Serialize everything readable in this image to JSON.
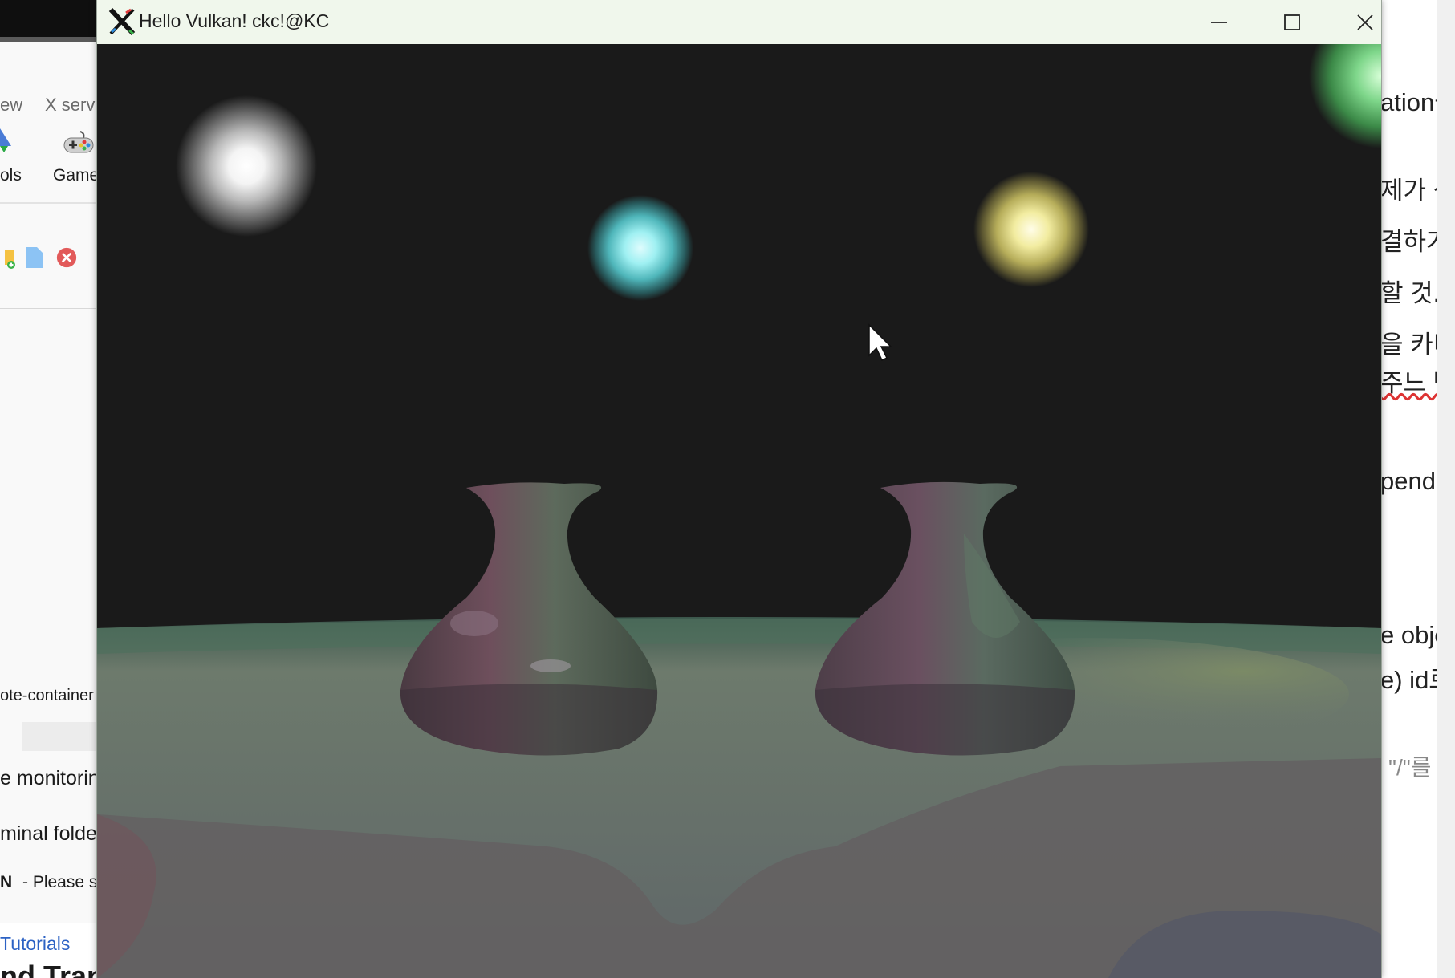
{
  "window": {
    "title": "Hello Vulkan! ckc!@KC",
    "buttons": [
      "minimize",
      "maximize",
      "close"
    ]
  },
  "left_app": {
    "tabs": [
      "ew",
      "X serv"
    ],
    "ribbon_items": [
      "ols",
      "Game"
    ],
    "list_items": [
      "ote-container",
      "e monitorin",
      "minal folde"
    ],
    "notice_prefix": "N",
    "notice_text": "-   Please s",
    "link": "Tutorials",
    "heading": "nd Tran"
  },
  "right_doc": {
    "lines": [
      "ation을",
      "제가 생",
      "결하거",
      "할 것.",
      "을 카디",
      "주느 방",
      "pender",
      "e objec",
      "e) id로",
      "\"/\"를"
    ]
  },
  "scene": {
    "background": "#1a1a1a",
    "lights": [
      {
        "color": "#ffffff",
        "name": "white-light"
      },
      {
        "color": "#7fe3e8",
        "name": "cyan-light"
      },
      {
        "color": "#f2eca0",
        "name": "yellow-light"
      },
      {
        "color": "#7ed68a",
        "name": "green-light"
      }
    ],
    "objects": [
      "vase-left",
      "vase-right",
      "floor-plane"
    ]
  }
}
